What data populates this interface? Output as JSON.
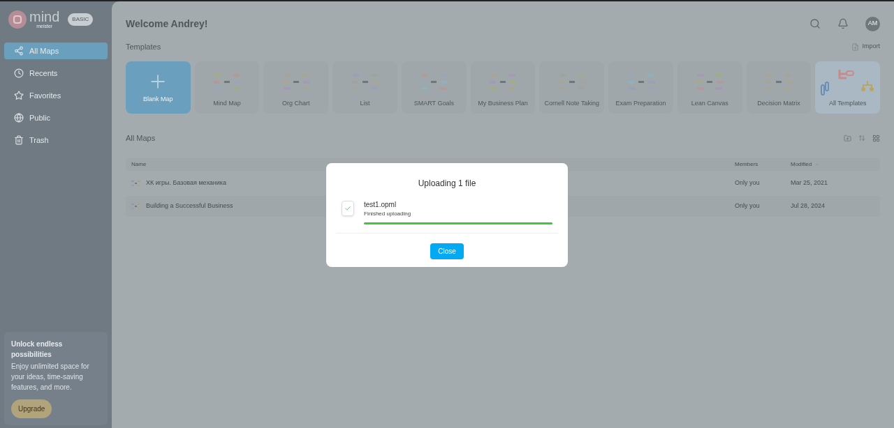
{
  "brand": {
    "name": "mind",
    "sub": "meister",
    "plan": "BASIC"
  },
  "sidebar": {
    "items": [
      {
        "label": "All Maps",
        "selected": true
      },
      {
        "label": "Recents",
        "selected": false
      },
      {
        "label": "Favorites",
        "selected": false
      },
      {
        "label": "Public",
        "selected": false
      },
      {
        "label": "Trash",
        "selected": false
      }
    ],
    "promo": {
      "title": "Unlock endless possibilities",
      "text": "Enjoy unlimited space for your ideas, time-saving features, and more.",
      "button": "Upgrade"
    }
  },
  "header": {
    "title": "Welcome Andrey!",
    "avatar": "AM"
  },
  "templates": {
    "title": "Templates",
    "import": "Import",
    "items": [
      {
        "label": "Blank Map",
        "kind": "blank"
      },
      {
        "label": "Mind Map",
        "kind": "template"
      },
      {
        "label": "Org Chart",
        "kind": "template"
      },
      {
        "label": "List",
        "kind": "template"
      },
      {
        "label": "SMART Goals",
        "kind": "template"
      },
      {
        "label": "My Business Plan",
        "kind": "template"
      },
      {
        "label": "Cornell Note Taking",
        "kind": "template"
      },
      {
        "label": "Exam Preparation",
        "kind": "template"
      },
      {
        "label": "Lean Canvas",
        "kind": "template"
      },
      {
        "label": "Decision Matrix",
        "kind": "template"
      },
      {
        "label": "All Templates",
        "kind": "all"
      }
    ]
  },
  "maps": {
    "title": "All Maps",
    "columns": [
      "Name",
      "Members",
      "Modified"
    ],
    "rows": [
      {
        "name": "ХК игры. Базовая механика",
        "members": "Only you",
        "modified": "Mar 25, 2021"
      },
      {
        "name": "Building a Successful Business",
        "members": "Only you",
        "modified": "Jul 28, 2024"
      }
    ]
  },
  "dialog": {
    "title": "Uploading 1 file",
    "file": "test1.opml",
    "status": "Finished uploading",
    "level": 1,
    "button": "Close"
  }
}
